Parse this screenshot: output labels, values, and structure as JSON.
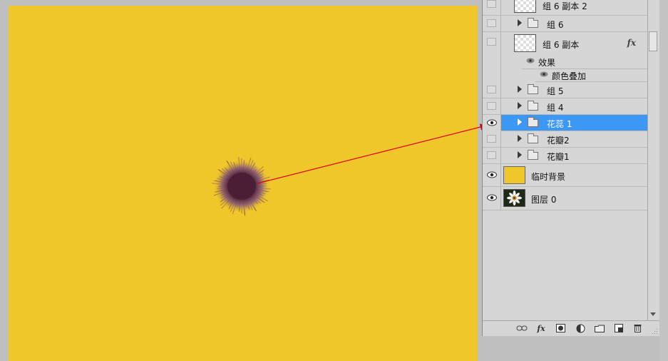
{
  "colors": {
    "canvas_fill": "#efc72a",
    "selection": "#3d97f4",
    "arrow": "#e00000",
    "flower_center": "#4a1e34"
  },
  "layers": [
    {
      "id": "group6-copy2",
      "name": "组 6 副本 2",
      "type": "layer",
      "visible": false
    },
    {
      "id": "group6",
      "name": "组 6",
      "type": "group",
      "visible": false
    },
    {
      "id": "group6-copy",
      "name": "组 6 副本",
      "type": "layer",
      "visible": false,
      "fx": "fx"
    },
    {
      "id": "effects",
      "name": "效果",
      "type": "effect-header"
    },
    {
      "id": "color-overlay",
      "name": "颜色叠加",
      "type": "effect"
    },
    {
      "id": "group5",
      "name": "组 5",
      "type": "group",
      "visible": false
    },
    {
      "id": "group4",
      "name": "组 4",
      "type": "group",
      "visible": false
    },
    {
      "id": "stamen1",
      "name": "花蕊 1",
      "type": "group",
      "visible": true,
      "selected": true
    },
    {
      "id": "petal2",
      "name": "花瓣2",
      "type": "group",
      "visible": false
    },
    {
      "id": "petal1",
      "name": "花瓣1",
      "type": "group",
      "visible": false
    },
    {
      "id": "temp-bg",
      "name": "临时背景",
      "type": "layer",
      "visible": true
    },
    {
      "id": "layer0",
      "name": "图层 0",
      "type": "layer",
      "visible": true
    }
  ],
  "toolbar": {
    "icons": [
      "link-icon",
      "fx-icon",
      "mask-icon",
      "adjustment-icon",
      "new-group-icon",
      "new-layer-icon",
      "trash-icon"
    ],
    "fx_label": "fx"
  }
}
